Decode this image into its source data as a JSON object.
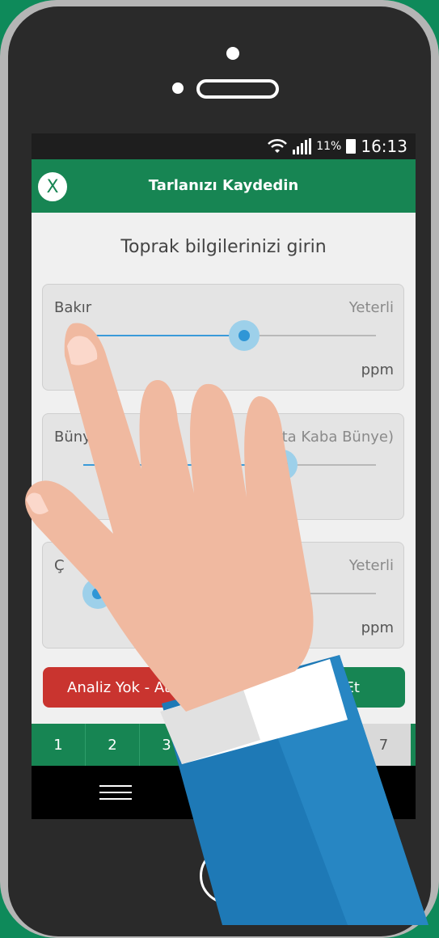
{
  "status_bar": {
    "battery_pct": "11%",
    "time": "16:13"
  },
  "app_bar": {
    "close_label": "X",
    "title": "Tarlanızı Kaydedin"
  },
  "prompt": "Toprak bilgilerinizi girin",
  "cards": [
    {
      "label": "Bakır",
      "status": "Yeterli",
      "unit": "ppm",
      "level": 0.55
    },
    {
      "label": "Büny",
      "status": "T    Orta Kaba Bünye)",
      "unit": "",
      "level": 0.68
    },
    {
      "label": "Ç",
      "status": "Yeterli",
      "unit": "ppm",
      "level": 0.05
    }
  ],
  "buttons": {
    "no_analysis": "Analiz Yok - At",
    "save": "Et"
  },
  "number_bar": [
    "1",
    "2",
    "3",
    "",
    "",
    "",
    "7"
  ],
  "colors": {
    "primary_green": "#178553",
    "danger_red": "#c9342f",
    "slider_blue": "#2f96d6"
  },
  "icons": {
    "close": "close-icon",
    "wifi": "wifi-icon",
    "signal": "signal-icon",
    "battery": "battery-icon",
    "menu": "menu-icon"
  }
}
